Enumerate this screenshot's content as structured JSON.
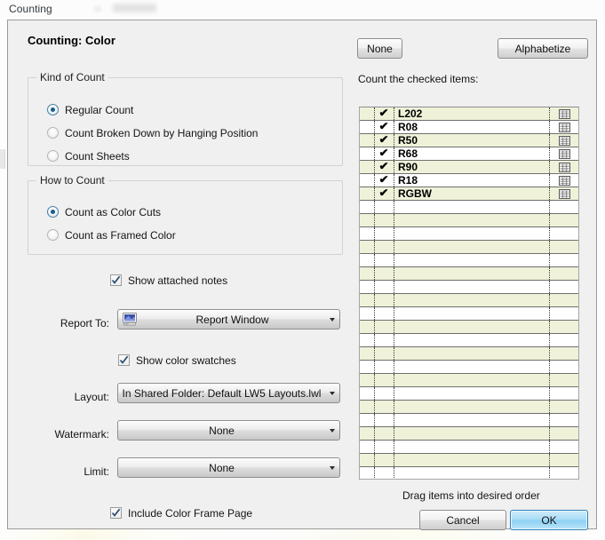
{
  "window": {
    "title": "Counting"
  },
  "dialog": {
    "heading": "Counting: Color",
    "groups": {
      "kind_of_count": {
        "title": "Kind of Count",
        "options": [
          {
            "label": "Regular Count",
            "selected": true
          },
          {
            "label": "Count Broken Down by Hanging Position",
            "selected": false
          },
          {
            "label": "Count Sheets",
            "selected": false
          }
        ]
      },
      "how_to_count": {
        "title": "How to Count",
        "options": [
          {
            "label": "Count as Color Cuts",
            "selected": true
          },
          {
            "label": "Count as Framed Color",
            "selected": false
          }
        ]
      }
    },
    "checkboxes": {
      "show_attached_notes": {
        "label": "Show attached notes",
        "checked": true
      },
      "show_color_swatches": {
        "label": "Show color swatches",
        "checked": true
      },
      "include_color_frame_page": {
        "label": "Include Color Frame Page",
        "checked": true
      }
    },
    "fields": [
      {
        "label": "Report To:",
        "value": "Report Window",
        "icon": "monitor-icon"
      },
      {
        "label": "Layout:",
        "value": "In Shared Folder: Default LW5 Layouts.lwl",
        "icon": ""
      },
      {
        "label": "Watermark:",
        "value": "None",
        "icon": ""
      },
      {
        "label": "Limit:",
        "value": "None",
        "icon": ""
      }
    ],
    "right_pane": {
      "none_button": "None",
      "alphabetize_button": "Alphabetize",
      "list_caption": "Count the checked items:",
      "drag_hint": "Drag items into desired order",
      "items": [
        {
          "name": "L202",
          "checked": true
        },
        {
          "name": "R08",
          "checked": true
        },
        {
          "name": "R50",
          "checked": true
        },
        {
          "name": "R68",
          "checked": true
        },
        {
          "name": "R90",
          "checked": true
        },
        {
          "name": "R18",
          "checked": true
        },
        {
          "name": "RGBW",
          "checked": true
        }
      ],
      "empty_row_count": 21,
      "row_icon": "grid-table-icon",
      "check_glyph": "✔"
    },
    "footer": {
      "cancel_button": "Cancel",
      "ok_button": "OK"
    }
  },
  "colors": {
    "dialog_bg": "#f0f0f0",
    "row_highlight": "#eff2d9",
    "default_button_accent": "#2f82b8",
    "radio_dot": "#1d5c86"
  }
}
